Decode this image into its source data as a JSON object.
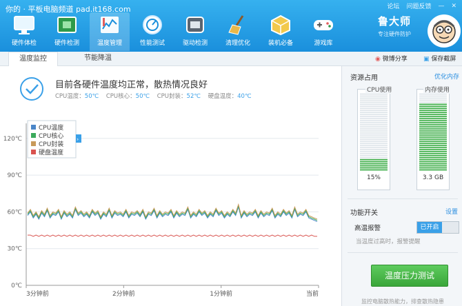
{
  "header": {
    "site_title": "你的 · 平板电脑频道 pad.it168.com",
    "window_controls": [
      "论坛",
      "问题反馈"
    ],
    "nav": [
      {
        "label": "硬件体检",
        "icon": "monitor-icon",
        "active": false
      },
      {
        "label": "硬件检测",
        "icon": "chip-icon",
        "active": false
      },
      {
        "label": "温度管理",
        "icon": "thermometer-icon",
        "active": true
      },
      {
        "label": "性能测试",
        "icon": "gauge-icon",
        "active": false
      },
      {
        "label": "驱动检测",
        "icon": "driver-icon",
        "active": false
      },
      {
        "label": "清理优化",
        "icon": "broom-icon",
        "active": false
      },
      {
        "label": "装机必备",
        "icon": "box-icon",
        "active": false
      },
      {
        "label": "游戏库",
        "icon": "gamepad-icon",
        "active": false
      }
    ],
    "brand_name": "鲁大师",
    "brand_slogan": "专注硬件防护"
  },
  "tabs": {
    "temp_monitor": "温度监控",
    "power_save": "节能降温",
    "share": "微博分享",
    "screenshot": "保存截屏"
  },
  "status": {
    "title": "目前各硬件温度均正常，散热情况良好",
    "readouts": [
      {
        "label": "CPU温度：",
        "value": "50℃"
      },
      {
        "label": "CPU核心：",
        "value": "50℃"
      },
      {
        "label": "CPU封装：",
        "value": "52℃"
      },
      {
        "label": "硬盘温度：",
        "value": "40℃"
      }
    ]
  },
  "chart_data": {
    "type": "line",
    "title": "",
    "xlabel": "",
    "ylabel": "",
    "ylim": [
      0,
      130
    ],
    "yticks": [
      "0℃",
      "30℃",
      "60℃",
      "90℃",
      "120℃"
    ],
    "xticks": [
      "3分钟前",
      "2分钟前",
      "1分钟前",
      "当前"
    ],
    "grid": true,
    "legend_placement": "top-left",
    "series": [
      {
        "name": "CPU温度",
        "color": "#4a86c8",
        "values": [
          57,
          60,
          55,
          58,
          54,
          59,
          56,
          61,
          55,
          58,
          57,
          60,
          54,
          59,
          56,
          58,
          55,
          62,
          57,
          59,
          56,
          58,
          55,
          60,
          57,
          59,
          54,
          58,
          56,
          61,
          55,
          59,
          57,
          58,
          56,
          60,
          55,
          58,
          57,
          59,
          56,
          60,
          54,
          58,
          57,
          61,
          55,
          59,
          56,
          58,
          57,
          60,
          55,
          59,
          56,
          58,
          57,
          62,
          55,
          58,
          56,
          60,
          57,
          59,
          55,
          58,
          56,
          61,
          57,
          59,
          55,
          58,
          56,
          60,
          57,
          64,
          55,
          59,
          56,
          58,
          57,
          60,
          55,
          59,
          56,
          58,
          57,
          61,
          55,
          58,
          56,
          60,
          57,
          59,
          55,
          62,
          56,
          58,
          57,
          60,
          55,
          54,
          53,
          52
        ]
      },
      {
        "name": "CPU核心",
        "color": "#3caa5c",
        "values": [
          58,
          61,
          56,
          59,
          55,
          60,
          57,
          62,
          56,
          59,
          58,
          61,
          55,
          60,
          57,
          59,
          56,
          63,
          58,
          60,
          57,
          59,
          56,
          61,
          58,
          60,
          55,
          59,
          57,
          62,
          56,
          60,
          58,
          59,
          57,
          61,
          56,
          59,
          58,
          60,
          57,
          61,
          55,
          59,
          58,
          62,
          56,
          60,
          57,
          59,
          58,
          61,
          56,
          60,
          57,
          59,
          58,
          63,
          56,
          59,
          57,
          61,
          58,
          60,
          56,
          59,
          57,
          62,
          58,
          60,
          56,
          59,
          57,
          61,
          58,
          65,
          56,
          60,
          57,
          59,
          58,
          61,
          56,
          60,
          57,
          59,
          58,
          62,
          56,
          59,
          57,
          61,
          58,
          60,
          56,
          63,
          57,
          59,
          58,
          61,
          56,
          55,
          54,
          53
        ]
      },
      {
        "name": "CPU封装",
        "color": "#c89a5a",
        "values": [
          59,
          62,
          57,
          60,
          56,
          61,
          58,
          63,
          57,
          60,
          59,
          62,
          56,
          61,
          58,
          60,
          57,
          64,
          59,
          61,
          58,
          60,
          57,
          62,
          59,
          61,
          56,
          60,
          58,
          63,
          57,
          61,
          59,
          60,
          58,
          62,
          57,
          60,
          59,
          61,
          58,
          62,
          56,
          60,
          59,
          63,
          57,
          61,
          58,
          60,
          59,
          62,
          57,
          61,
          58,
          60,
          59,
          64,
          57,
          60,
          58,
          62,
          59,
          61,
          57,
          60,
          58,
          63,
          59,
          61,
          57,
          60,
          58,
          62,
          59,
          66,
          57,
          61,
          58,
          60,
          59,
          62,
          57,
          61,
          58,
          60,
          59,
          63,
          57,
          60,
          58,
          62,
          59,
          61,
          57,
          64,
          58,
          60,
          59,
          62,
          57,
          56,
          55,
          54
        ]
      },
      {
        "name": "硬盘温度",
        "color": "#d9534f",
        "values": [
          41,
          41,
          40,
          41,
          40,
          41,
          40,
          41,
          40,
          41,
          40,
          41,
          40,
          41,
          40,
          41,
          40,
          41,
          40,
          41,
          40,
          41,
          40,
          41,
          40,
          41,
          40,
          41,
          40,
          41,
          40,
          41,
          40,
          41,
          40,
          41,
          40,
          41,
          40,
          41,
          40,
          41,
          40,
          41,
          40,
          41,
          40,
          41,
          40,
          41,
          40,
          41,
          40,
          41,
          40,
          41,
          40,
          41,
          40,
          41,
          40,
          41,
          40,
          41,
          40,
          41,
          40,
          41,
          40,
          41,
          40,
          41,
          40,
          41,
          40,
          41,
          40,
          41,
          40,
          41,
          40,
          41,
          40,
          41,
          40,
          41,
          40,
          41,
          40,
          41,
          40,
          41,
          40,
          41,
          40,
          41,
          40,
          41,
          40,
          41,
          40,
          41,
          40,
          40
        ]
      }
    ]
  },
  "side": {
    "usage_title": "资源占用",
    "optimize_link": "优化内存",
    "cpu_label": "CPU使用",
    "cpu_value": "15%",
    "cpu_fill": 0.15,
    "mem_label": "内存使用",
    "mem_value": "3.3 GB",
    "mem_fill": 0.88,
    "feature_title": "功能开关",
    "settings_link": "设置",
    "alarm_label": "高温报警",
    "toggle_on": "已开启",
    "alarm_hint": "当温度过高时，报警提醒",
    "stress_button": "温度压力测试",
    "stress_tip": "监控电脑散热能力，排查散热隐患"
  }
}
